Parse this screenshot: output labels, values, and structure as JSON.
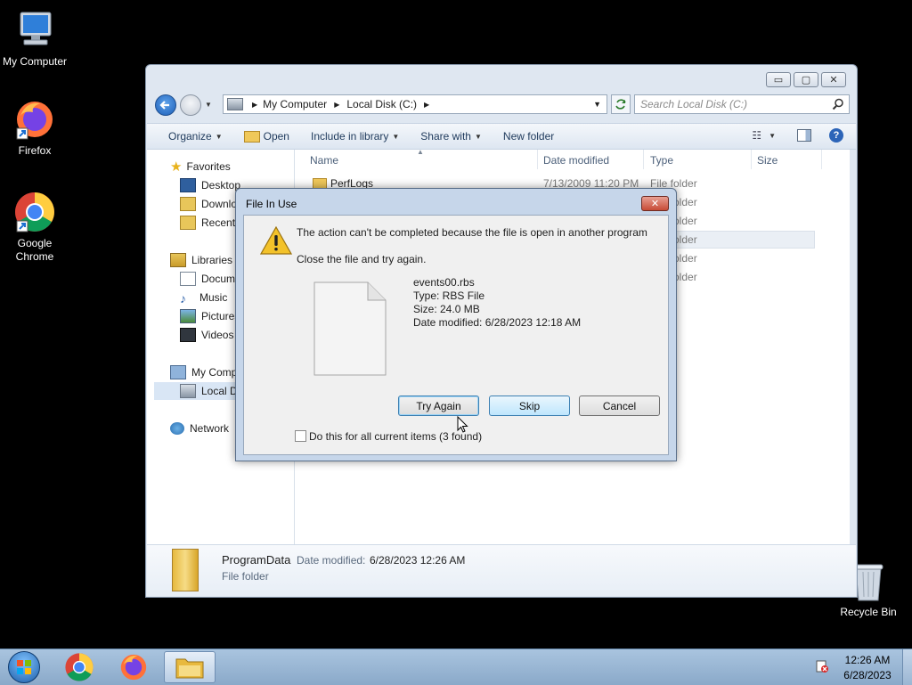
{
  "desktop": {
    "icons": [
      {
        "label": "My Computer",
        "icon": "computer-icon"
      },
      {
        "label": "Firefox",
        "icon": "firefox-icon"
      },
      {
        "label": "Google Chrome",
        "icon": "chrome-icon"
      },
      {
        "label": "Recycle Bin",
        "icon": "recycle-bin-icon"
      }
    ]
  },
  "explorer": {
    "buttons": {
      "minimize": "▭",
      "maximize": "▢",
      "close": "✕"
    },
    "breadcrumb": [
      "My Computer",
      "Local Disk (C:)"
    ],
    "search_placeholder": "Search Local Disk (C:)",
    "toolbar": {
      "organize": "Organize",
      "open": "Open",
      "include_in_library": "Include in library",
      "share_with": "Share with",
      "new_folder": "New folder"
    },
    "nav": {
      "favorites": "Favorites",
      "desktop": "Desktop",
      "downloads": "Downloads",
      "recent": "Recent Places",
      "libraries": "Libraries",
      "documents": "Documents",
      "music": "Music",
      "pictures": "Pictures",
      "videos": "Videos",
      "my_computer": "My Computer",
      "local_disk": "Local Disk (C:)",
      "network": "Network"
    },
    "columns": {
      "name": "Name",
      "date_modified": "Date modified",
      "type": "Type",
      "size": "Size"
    },
    "files": [
      {
        "name": "PerfLogs",
        "date": "7/13/2009 11:20 PM",
        "type": "File folder"
      },
      {
        "type": "File folder"
      },
      {
        "type": "File folder"
      },
      {
        "type": "File folder"
      },
      {
        "type": "File folder"
      },
      {
        "type": "File folder"
      }
    ],
    "details": {
      "name": "ProgramData",
      "date_label": "Date modified:",
      "date_value": "6/28/2023 12:26 AM",
      "type": "File folder"
    }
  },
  "dialog": {
    "title": "File In Use",
    "message": "The action can't be completed because the file is open in another program",
    "hint": "Close the file and try again.",
    "file": {
      "name": "events00.rbs",
      "type": "Type: RBS File",
      "size": "Size: 24.0 MB",
      "modified": "Date modified: 6/28/2023 12:18 AM"
    },
    "buttons": {
      "try_again": "Try Again",
      "skip": "Skip",
      "cancel": "Cancel"
    },
    "checkbox_label": "Do this for all current items (3 found)",
    "checkbox_checked": false
  },
  "taskbar": {
    "time": "12:26 AM",
    "date": "6/28/2023"
  }
}
